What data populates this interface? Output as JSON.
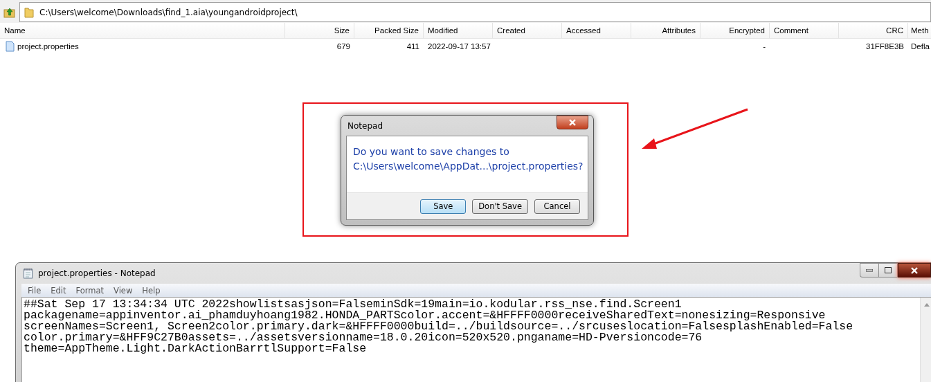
{
  "address_bar": {
    "path": "C:\\Users\\welcome\\Downloads\\find_1.aia\\youngandroidproject\\"
  },
  "file_list": {
    "columns": [
      "Name",
      "Size",
      "Packed Size",
      "Modified",
      "Created",
      "Accessed",
      "Attributes",
      "Encrypted",
      "Comment",
      "CRC",
      "Meth"
    ],
    "rows": [
      {
        "cells": [
          "project.properties",
          "679",
          "411",
          "2022-09-17 13:57",
          "",
          "",
          "",
          "-",
          "",
          "31FF8E3B",
          "Defla"
        ],
        "selected": false
      }
    ]
  },
  "dialog": {
    "title": "Notepad",
    "message_lines": [
      "Do you want to save changes to",
      "C:\\Users\\welcome\\AppDat...\\project.properties?"
    ],
    "buttons": [
      {
        "label": "Save",
        "focused": true
      },
      {
        "label": "Don't Save",
        "focused": false
      },
      {
        "label": "Cancel",
        "focused": false
      }
    ]
  },
  "notepad": {
    "title": "project.properties - Notepad",
    "menu": [
      "File",
      "Edit",
      "Format",
      "View",
      "Help"
    ],
    "lines": [
      "##Sat Sep 17 13:34:34 UTC 2022showlistsasjson=FalseminSdk=19main=io.kodular.rss_nse.find.Screen1",
      "packagename=appinventor.ai_phamduyhoang1982.HONDA_PARTScolor.accent=&HFFFF0000receiveSharedText=nonesizing=Responsive",
      "screenNames=Screen1, Screen2color.primary.dark=&HFFFF0000build=../buildsource=../srcuseslocation=FalsesplashEnabled=False",
      "color.primary=&HFF9C27B0assets=../assetsversionname=18.0.20icon=520x520.pnganame=HD-Pversioncode=76",
      "theme=AppTheme.Light.DarkActionBarrtlSupport=False"
    ]
  }
}
